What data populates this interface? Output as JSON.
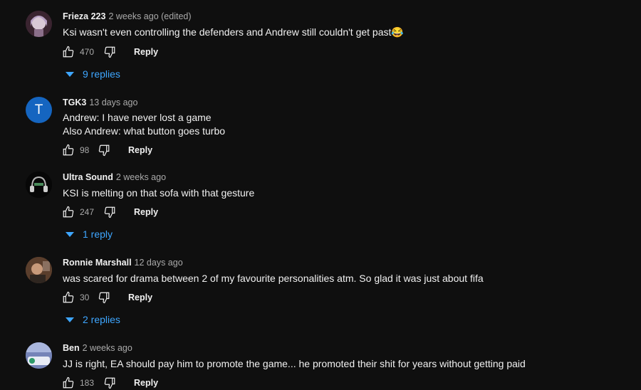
{
  "comments": [
    {
      "author": "Frieza 223",
      "time": "2 weeks ago (edited)",
      "lines": [
        "Ksi wasn't even controlling the defenders and Andrew still couldn't get past😂"
      ],
      "likes": "470",
      "reply_label": "Reply",
      "replies": "9 replies",
      "avatar_icon": "anime-avatar-image"
    },
    {
      "author": "TGK3",
      "time": "13 days ago",
      "lines": [
        "Andrew: I have never lost a game",
        "Also Andrew: what button goes turbo"
      ],
      "likes": "98",
      "reply_label": "Reply",
      "avatar_letter": "T",
      "avatar_color": "#1565c0"
    },
    {
      "author": "Ultra Sound",
      "time": "2 weeks ago",
      "lines": [
        "KSI is melting on that sofa with that gesture"
      ],
      "likes": "247",
      "reply_label": "Reply",
      "replies": "1 reply",
      "avatar_icon": "headphones-avatar-image"
    },
    {
      "author": "Ronnie Marshall",
      "time": "12 days ago",
      "lines": [
        "was scared for drama between 2 of my favourite personalities atm. So glad it was just about fifa"
      ],
      "likes": "30",
      "reply_label": "Reply",
      "replies": "2 replies",
      "avatar_icon": "photo-avatar-image"
    },
    {
      "author": "Ben",
      "time": "2 weeks ago",
      "lines": [
        "JJ is right, EA should pay him to promote the game... he promoted their shit for years without getting paid"
      ],
      "likes": "183",
      "reply_label": "Reply",
      "avatar_icon": "game-avatar-image"
    }
  ],
  "colors": {
    "background": "#0f0f0f",
    "text": "#f1f1f1",
    "secondary": "#aaaaaa",
    "link": "#3ea6ff"
  }
}
